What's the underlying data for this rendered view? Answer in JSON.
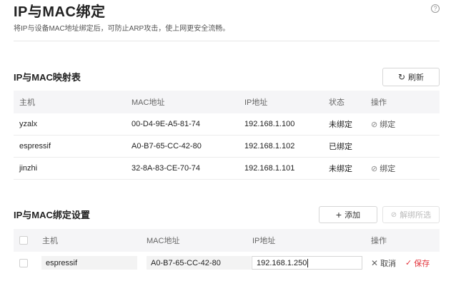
{
  "page": {
    "title": "IP与MAC绑定",
    "description": "将IP与设备MAC地址绑定后，可防止ARP攻击，使上网更安全流畅。",
    "help_icon": "?"
  },
  "mapping_table": {
    "title": "IP与MAC映射表",
    "refresh_label": "刷新",
    "columns": [
      "主机",
      "MAC地址",
      "IP地址",
      "状态",
      "操作"
    ],
    "rows": [
      {
        "host": "yzalx",
        "mac": "00-D4-9E-A5-81-74",
        "ip": "192.168.1.100",
        "status": "未绑定",
        "action": "绑定"
      },
      {
        "host": "espressif",
        "mac": "A0-B7-65-CC-42-80",
        "ip": "192.168.1.102",
        "status": "已绑定",
        "action": ""
      },
      {
        "host": "jinzhi",
        "mac": "32-8A-83-CE-70-74",
        "ip": "192.168.1.101",
        "status": "未绑定",
        "action": "绑定"
      }
    ]
  },
  "binding_settings": {
    "title": "IP与MAC绑定设置",
    "add_label": "添加",
    "unbind_label": "解绑所选",
    "columns": [
      "主机",
      "MAC地址",
      "IP地址",
      "操作"
    ],
    "edit_row": {
      "host": "espressif",
      "mac": "A0-B7-65-CC-42-80",
      "ip": "192.168.1.250",
      "cancel_label": "取消",
      "save_label": "保存"
    }
  },
  "colors": {
    "accent_red": "#e3343c",
    "header_bg": "#f5f5f7"
  }
}
